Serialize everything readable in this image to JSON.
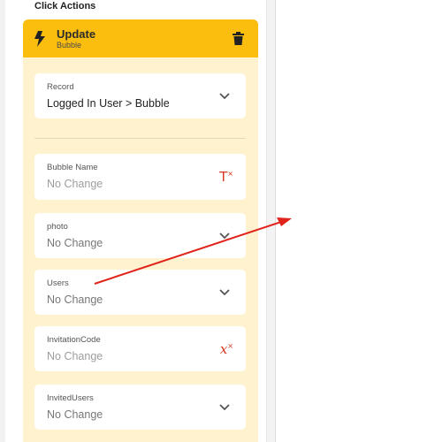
{
  "section": {
    "title": "Click Actions"
  },
  "action": {
    "title": "Update",
    "subtitle": "Bubble"
  },
  "fields": [
    {
      "label": "Record",
      "value": "Logged In User > Bubble",
      "icon": "chevron-down-icon"
    },
    {
      "label": "Bubble Name",
      "value": "No Change",
      "icon": "text-variable-icon"
    },
    {
      "label": "photo",
      "value": "No Change",
      "icon": "chevron-down-icon"
    },
    {
      "label": "Users",
      "value": "No Change",
      "icon": "chevron-down-icon"
    },
    {
      "label": "InvitationCode",
      "value": "No Change",
      "icon": "fx-variable-icon"
    },
    {
      "label": "InvitedUsers",
      "value": "No Change",
      "icon": "chevron-down-icon"
    }
  ],
  "colors": {
    "header": "#fbbe0e",
    "card": "#fef2cf",
    "accent": "#d6361e",
    "arrow": "#e0231b"
  }
}
